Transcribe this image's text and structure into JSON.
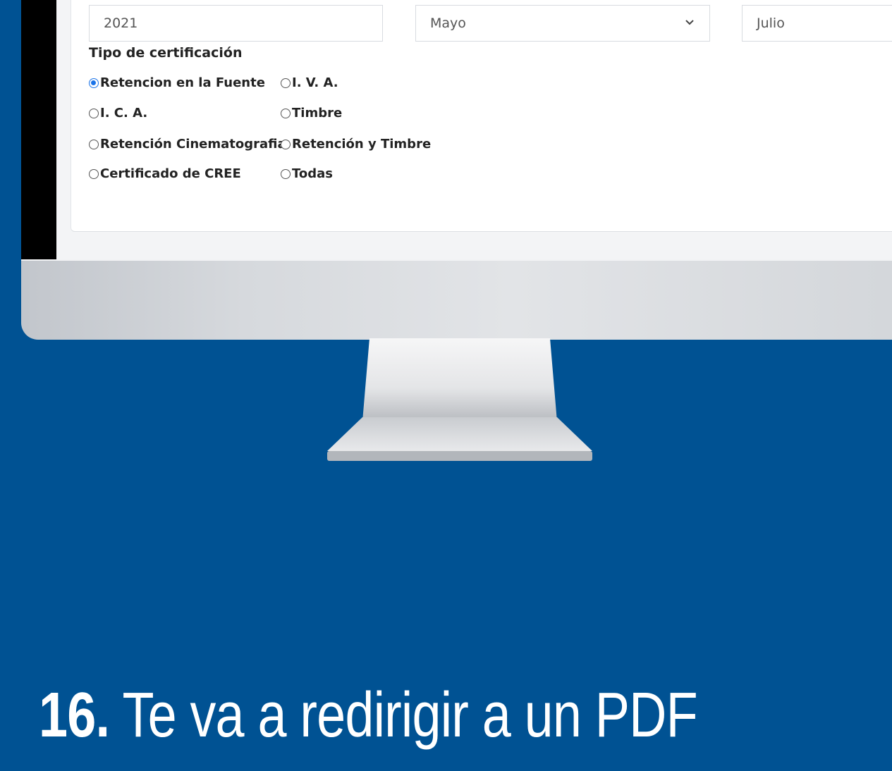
{
  "form": {
    "year_value": "2021",
    "month_start_value": "Mayo",
    "month_end_value": "Julio",
    "certification_title": "Tipo de certificación",
    "options": [
      {
        "label": "Retencion en la Fuente",
        "checked": true
      },
      {
        "label": "I. V. A.",
        "checked": false
      },
      {
        "label": "I. C. A.",
        "checked": false
      },
      {
        "label": "Timbre",
        "checked": false
      },
      {
        "label": "Retención Cinematografia",
        "checked": false
      },
      {
        "label": "Retención y Timbre",
        "checked": false
      },
      {
        "label": "Certificado de CREE",
        "checked": false
      },
      {
        "label": "Todas",
        "checked": false
      }
    ]
  },
  "caption": {
    "number": "16.",
    "text": " Te va a redirigir a un PDF"
  },
  "colors": {
    "background": "#005293",
    "radio_checked": "#1a73e8"
  }
}
